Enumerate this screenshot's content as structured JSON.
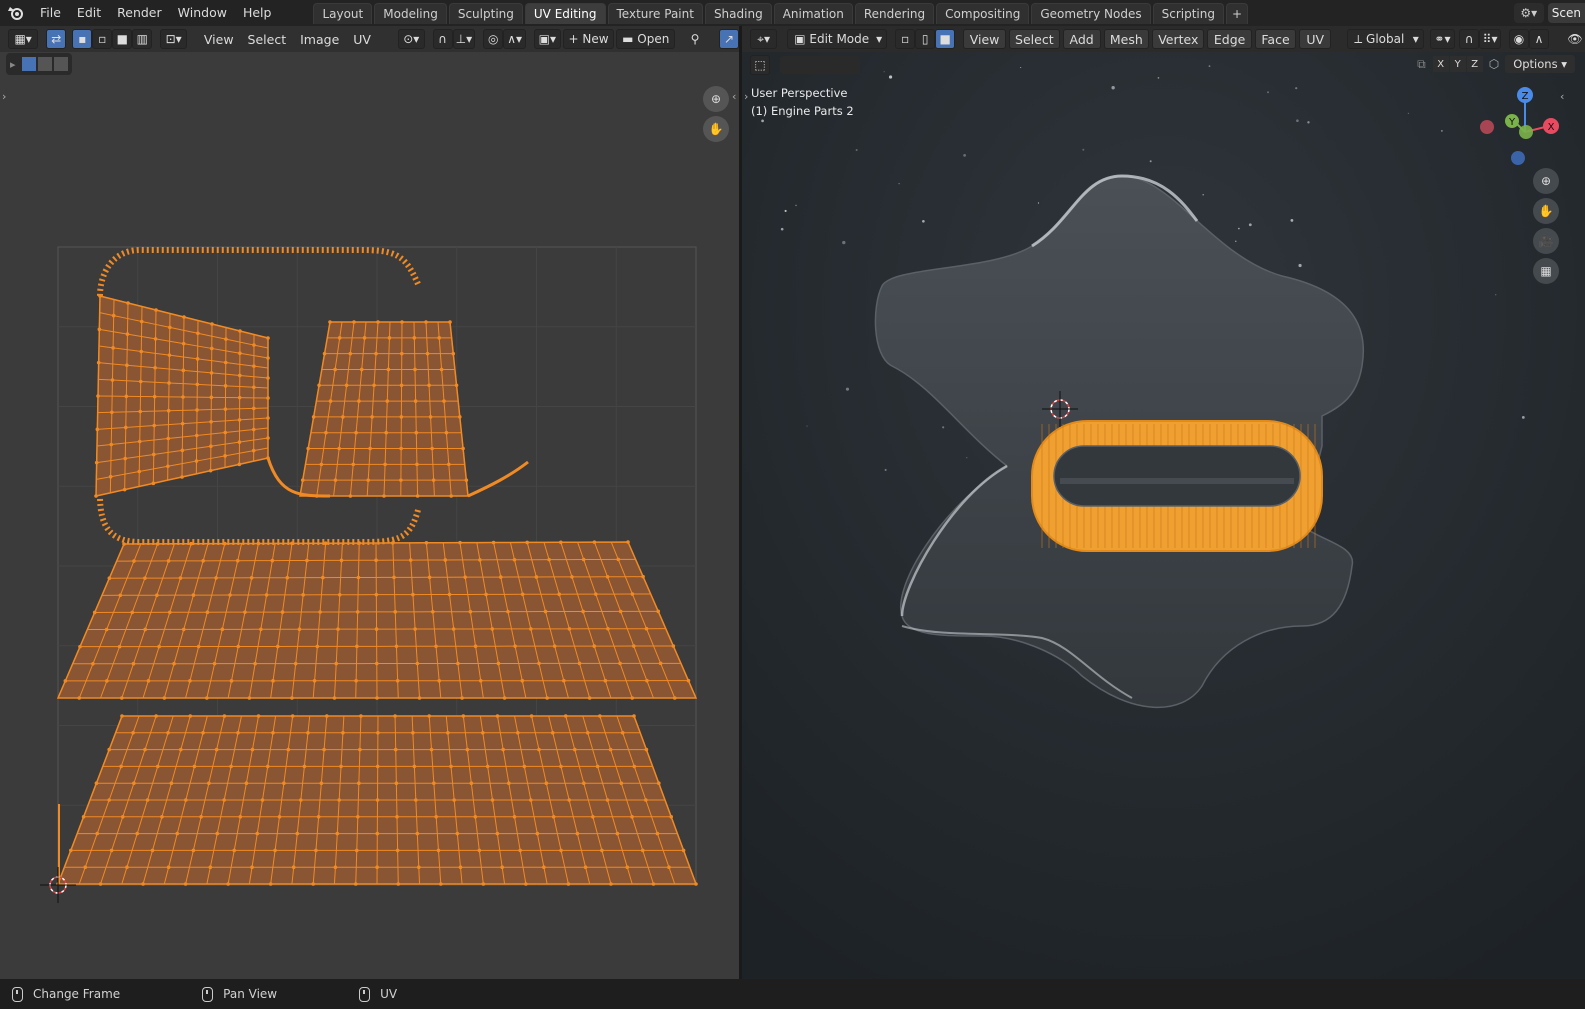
{
  "app": {
    "logo_icon": "blender-logo-icon"
  },
  "menu": [
    "File",
    "Edit",
    "Render",
    "Window",
    "Help"
  ],
  "workspace_tabs": [
    {
      "label": "Layout",
      "active": false
    },
    {
      "label": "Modeling",
      "active": false
    },
    {
      "label": "Sculpting",
      "active": false
    },
    {
      "label": "UV Editing",
      "active": true
    },
    {
      "label": "Texture Paint",
      "active": false
    },
    {
      "label": "Shading",
      "active": false
    },
    {
      "label": "Animation",
      "active": false
    },
    {
      "label": "Rendering",
      "active": false
    },
    {
      "label": "Compositing",
      "active": false
    },
    {
      "label": "Geometry Nodes",
      "active": false
    },
    {
      "label": "Scripting",
      "active": false
    }
  ],
  "add_tab_label": "+",
  "scene": {
    "label": "Scen"
  },
  "uv_editor": {
    "menus": [
      "View",
      "Select",
      "Image",
      "UV"
    ],
    "new_label": "New",
    "open_label": "Open",
    "mesh_color": "#f08a24",
    "face_color": "#8a5533"
  },
  "viewport": {
    "mode": "Edit Mode",
    "menus": [
      "View",
      "Select",
      "Add",
      "Mesh",
      "Vertex",
      "Edge",
      "Face",
      "UV"
    ],
    "orientation": "Global",
    "axes": [
      "X",
      "Y",
      "Z"
    ],
    "options_label": "Options",
    "perspective_label": "User Perspective",
    "object_label": "(1) Engine Parts 2",
    "gizmo": {
      "z": "Z",
      "y": "Y",
      "x": "X"
    },
    "selection_color": "#f0a030",
    "object_color": "#3d4247"
  },
  "statusbar": {
    "items": [
      "Change Frame",
      "Pan View",
      "UV"
    ]
  }
}
